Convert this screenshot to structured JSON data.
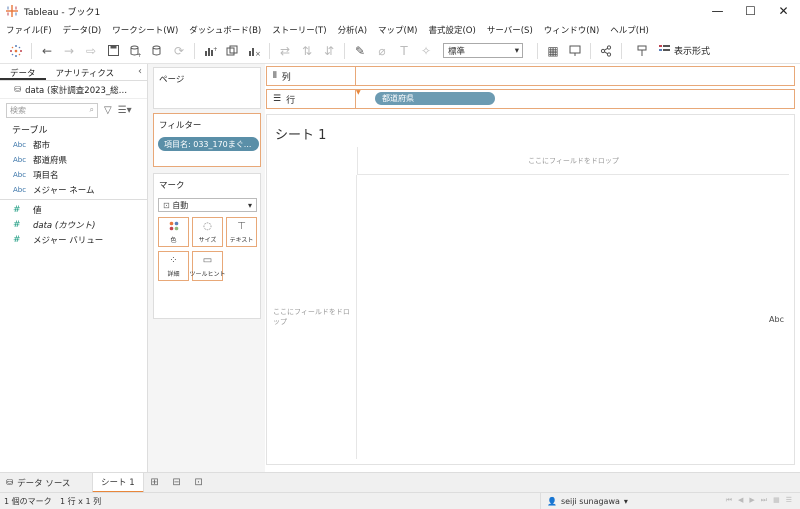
{
  "window": {
    "title": "Tableau - ブック1",
    "minimize": "—",
    "maximize": "☐",
    "close": "✕"
  },
  "menu": [
    "ファイル(F)",
    "データ(D)",
    "ワークシート(W)",
    "ダッシュボード(B)",
    "ストーリー(T)",
    "分析(A)",
    "マップ(M)",
    "書式設定(O)",
    "サーバー(S)",
    "ウィンドウ(N)",
    "ヘルプ(H)"
  ],
  "toolbar": {
    "fit_select": "標準",
    "show_me": "表示形式"
  },
  "datapane": {
    "tab_data": "データ",
    "tab_analytics": "アナリティクス",
    "source": "data (家計調査2023_総…",
    "search_placeholder": "検索",
    "section_tables": "テーブル",
    "dimensions": [
      {
        "type": "Abc",
        "name": "都市"
      },
      {
        "type": "Abc",
        "name": "都道府県"
      },
      {
        "type": "Abc",
        "name": "項目名"
      },
      {
        "type": "Abc",
        "name": "メジャー ネーム"
      }
    ],
    "measures": [
      {
        "type": "#",
        "name": "値"
      },
      {
        "type": "#",
        "name": "data (カウント)"
      },
      {
        "type": "#",
        "name": "メジャー バリュー"
      }
    ]
  },
  "cards": {
    "pages": "ページ",
    "filters": "フィルター",
    "filter_pill": "項目名: 033_170まぐ...",
    "marks": "マーク",
    "mark_type": "自動",
    "mark_buttons": [
      "色",
      "サイズ",
      "テキスト",
      "詳細",
      "ツールヒント"
    ]
  },
  "shelves": {
    "columns": "列",
    "rows": "行",
    "row_pill": "都道府県"
  },
  "sheet": {
    "title": "シート 1",
    "drop_top": "ここにフィールドをドロップ",
    "drop_left": "ここにフィールドをドロップ",
    "abc": "Abc"
  },
  "tabs": {
    "datasource": "データ ソース",
    "sheet1": "シート 1"
  },
  "status": {
    "marks": "1 個のマーク",
    "dims": "1 行 x 1 列",
    "user": "seiji sunagawa"
  },
  "colors": {
    "accent_orange": "#e8a878",
    "pill_blue": "#6c9bb2"
  }
}
